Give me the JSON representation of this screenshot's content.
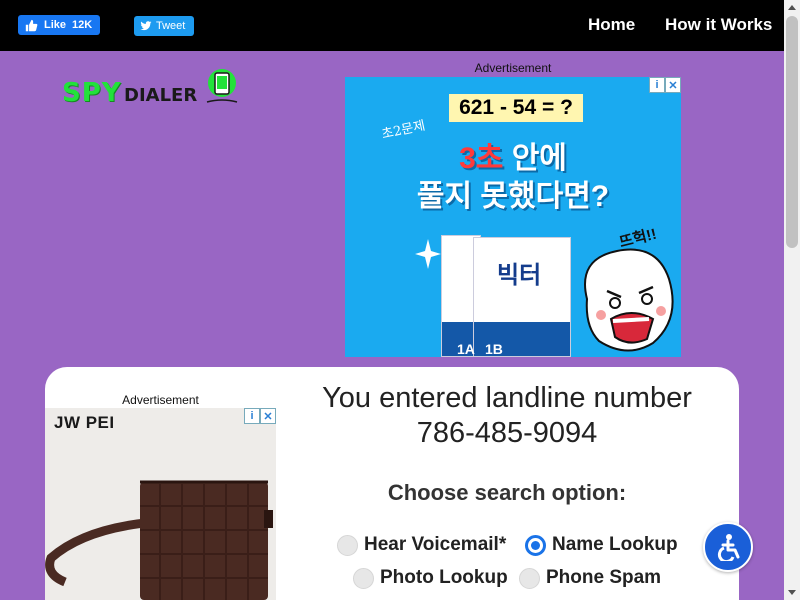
{
  "topbar": {
    "like_label": "Like",
    "like_count": "12K",
    "tweet_label": "Tweet",
    "nav": {
      "home": "Home",
      "how_it_works": "How it Works"
    }
  },
  "logo": {
    "part1": "SPY",
    "part2": "DIALER"
  },
  "ads": {
    "label": "Advertisement",
    "top": {
      "formula": "621 - 54 = ?",
      "handwriting": "초2문제",
      "line1_highlight": "3초",
      "line1_rest": " 안에",
      "line2": "풀지 못했다면?",
      "book_title": "빅터",
      "book_a": "1A",
      "book_b": "1B",
      "exclaim": "뜨헉!!"
    },
    "side": {
      "brand": "JW PEI"
    }
  },
  "main": {
    "heading_line1": "You entered landline number",
    "phone_number": "786-485-9094",
    "choose_label": "Choose search option:",
    "options": [
      {
        "label": "Hear Voicemail*",
        "selected": false
      },
      {
        "label": "Name Lookup",
        "selected": true
      },
      {
        "label": "Photo Lookup",
        "selected": false
      },
      {
        "label": "Phone Spam",
        "selected": false
      }
    ]
  },
  "colors": {
    "page_bg": "#9966c4",
    "topbar_bg": "#000000",
    "accent": "#1a73e8",
    "logo_green": "#22e23a"
  }
}
